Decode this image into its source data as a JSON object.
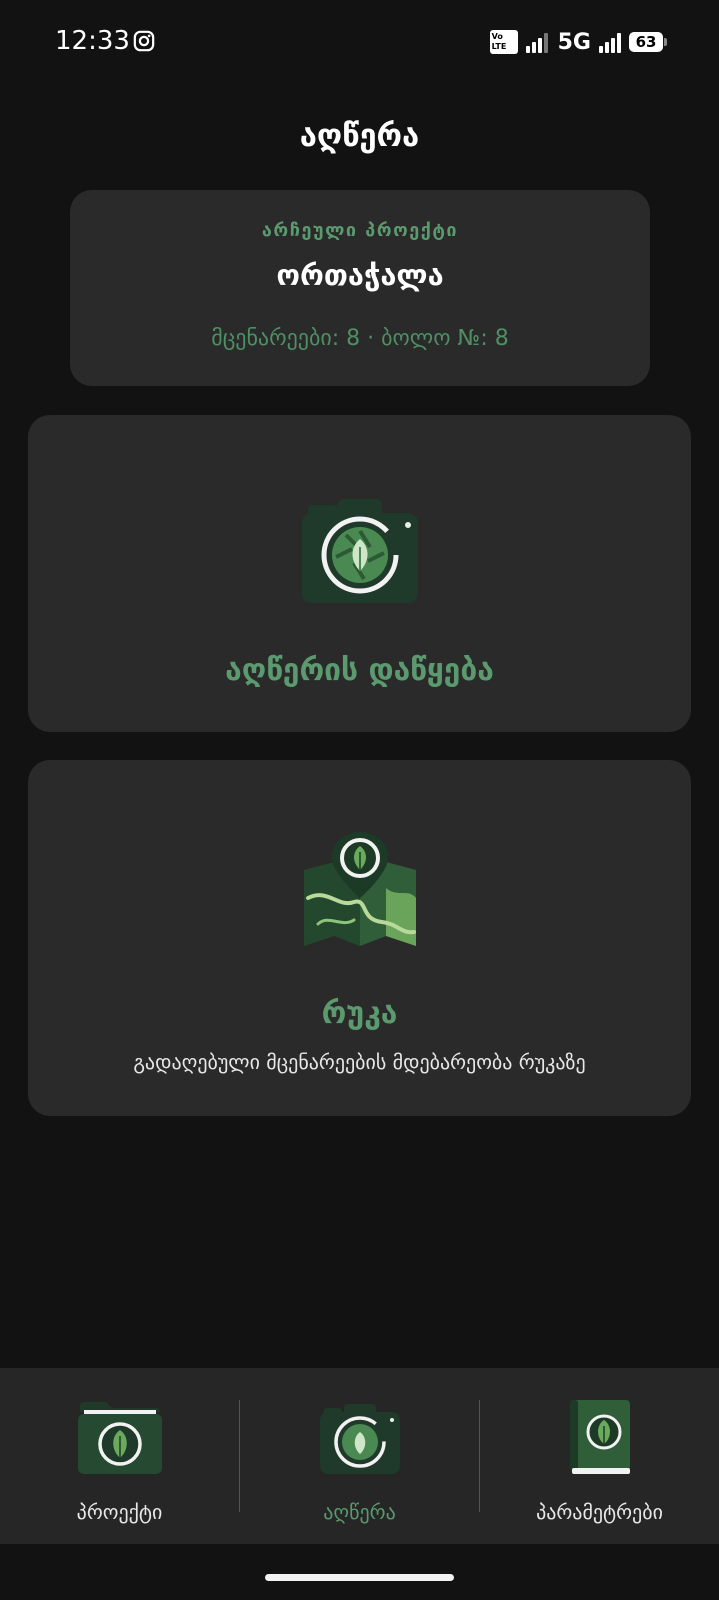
{
  "status_bar": {
    "time": "12:33",
    "network": "5G",
    "volte": "Vo LTE 2",
    "battery": "63"
  },
  "header": {
    "title": "აღწერა"
  },
  "project_card": {
    "label": "არჩეული პროექტი",
    "name": "ორთაჭალა",
    "stats": "მცენარეები: 8 · ბოლო №: 8"
  },
  "start_card": {
    "icon": "camera-leaf-icon",
    "title": "აღწერის დაწყება"
  },
  "map_card": {
    "icon": "map-pin-leaf-icon",
    "title": "რუკა",
    "subtitle": "გადაღებული მცენარეების მდებარეობა რუკაზე"
  },
  "bottom_nav": {
    "items": [
      {
        "label": "პროექტი",
        "icon": "folder-leaf-icon",
        "active": false
      },
      {
        "label": "აღწერა",
        "icon": "camera-leaf-icon",
        "active": true
      },
      {
        "label": "პარამეტრები",
        "icon": "book-leaf-icon",
        "active": false
      }
    ]
  },
  "colors": {
    "background": "#121212",
    "card": "#2a2a2a",
    "accent": "#5a9a6e",
    "nav_background": "#262626"
  }
}
